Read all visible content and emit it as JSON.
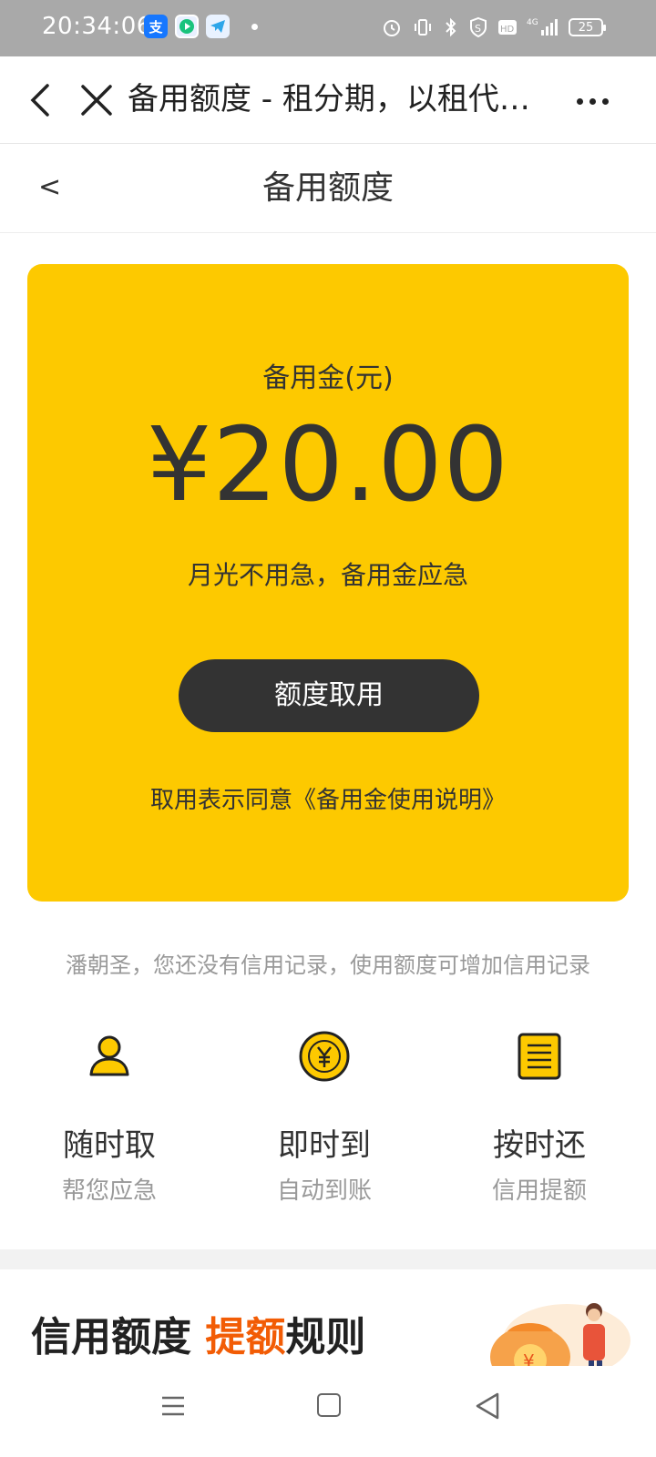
{
  "status_bar": {
    "time": "20:34:06",
    "battery": "25",
    "network": "4G"
  },
  "browser": {
    "title": "备用额度 - 租分期，以租代…"
  },
  "page": {
    "title": "备用额度",
    "back_label": "<"
  },
  "card": {
    "label": "备用金(元)",
    "amount": "¥20.00",
    "slogan": "月光不用急，备用金应急",
    "button": "额度取用",
    "agreement": "取用表示同意《备用金使用说明》",
    "background": "#fdc900"
  },
  "notice": "潘朝圣，您还没有信用记录，使用额度可增加信用记录",
  "features": [
    {
      "title": "随时取",
      "subtitle": "帮您应急",
      "icon": "user-icon"
    },
    {
      "title": "即时到",
      "subtitle": "自动到账",
      "icon": "yen-coin-icon"
    },
    {
      "title": "按时还",
      "subtitle": "信用提额",
      "icon": "document-icon"
    }
  ],
  "rules": {
    "prefix": "信用额度 ",
    "highlight": "提额",
    "suffix": "规则"
  },
  "colors": {
    "accent": "#fdc900",
    "highlight": "#f25c05",
    "button": "#333333"
  }
}
